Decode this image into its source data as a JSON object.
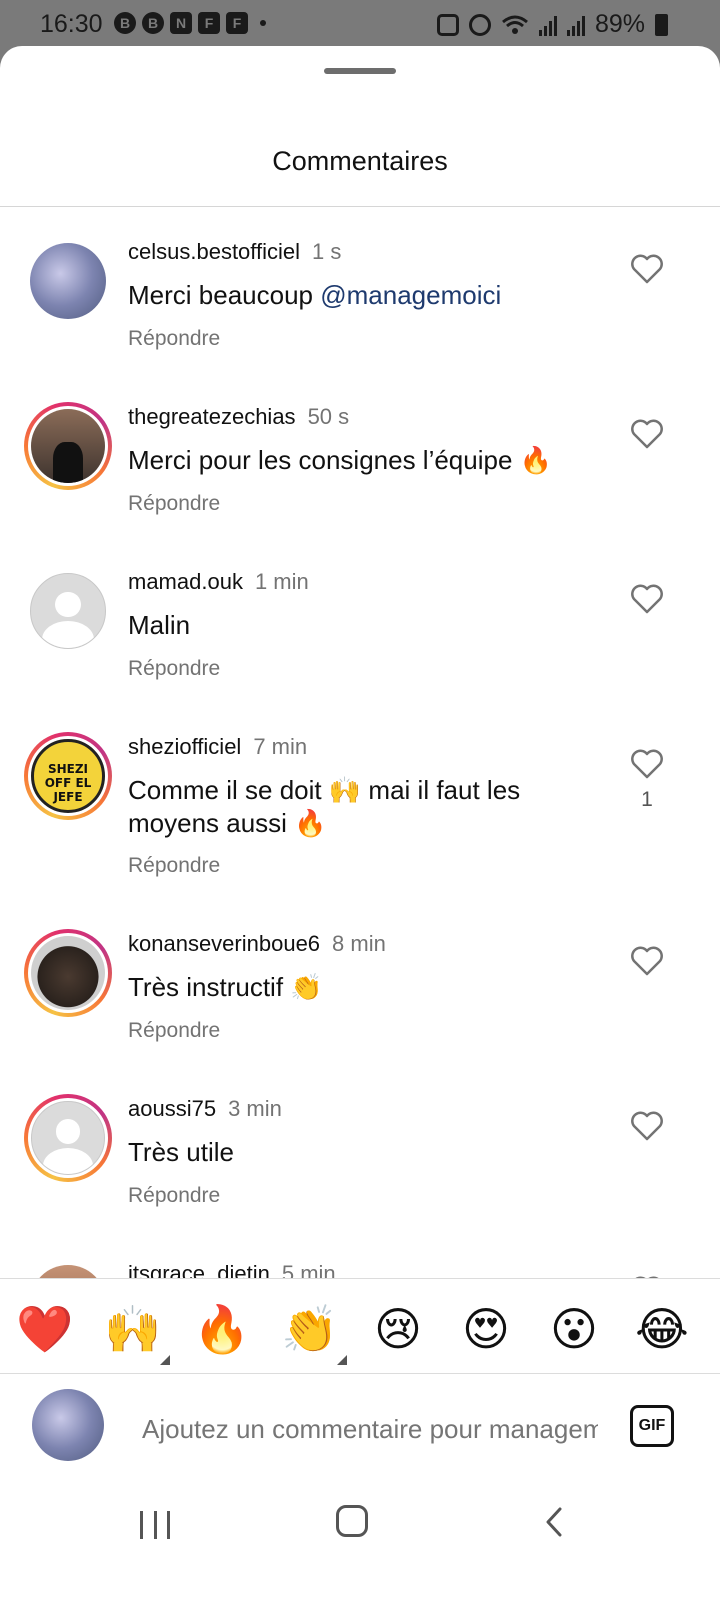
{
  "status_bar": {
    "time": "16:30",
    "battery": "89%",
    "app_icons": [
      "B",
      "N",
      "F",
      "F"
    ]
  },
  "sheet": {
    "title": "Commentaires"
  },
  "comments": [
    {
      "username": "celsus.bestofficiel",
      "time": "1 s",
      "text_before": "Merci beaucoup ",
      "mention": "@managemoici",
      "text_after": "",
      "reply": "Répondre",
      "likes": ""
    },
    {
      "username": "thegreatezechias",
      "time": "50 s",
      "text": "Merci pour les consignes l’équipe 🔥",
      "reply": "Répondre",
      "likes": ""
    },
    {
      "username": "mamad.ouk",
      "time": "1 min",
      "text": "Malin",
      "reply": "Répondre",
      "likes": ""
    },
    {
      "username": "sheziofficiel",
      "time": "7 min",
      "text": "Comme il se doit 🙌 mai il faut les moyens aussi 🔥",
      "reply": "Répondre",
      "likes": "1"
    },
    {
      "username": "konanseverinboue6",
      "time": "8 min",
      "text": "Très instructif 👏",
      "reply": "Répondre",
      "likes": ""
    },
    {
      "username": "aoussi75",
      "time": "3 min",
      "text": "Très utile",
      "reply": "Répondre",
      "likes": ""
    },
    {
      "username": "itsgrace_djetin",
      "time": "5 min",
      "text": "",
      "reply": "",
      "likes": ""
    }
  ],
  "avatar_text": {
    "shezi": "SHEZI OFF EL JEFE"
  },
  "emoji_bar": [
    "❤️",
    "🙌",
    "🔥",
    "👏",
    "😢",
    "😍",
    "😮",
    "😂"
  ],
  "input": {
    "placeholder": "Ajoutez un commentaire pour managemoici...",
    "gif_label": "GIF"
  },
  "colors": {
    "mention": "#1e3a6e",
    "secondary_text": "#737373",
    "ring_gradient": [
      "#f6c244",
      "#f77737",
      "#e1306c",
      "#c13584"
    ]
  }
}
